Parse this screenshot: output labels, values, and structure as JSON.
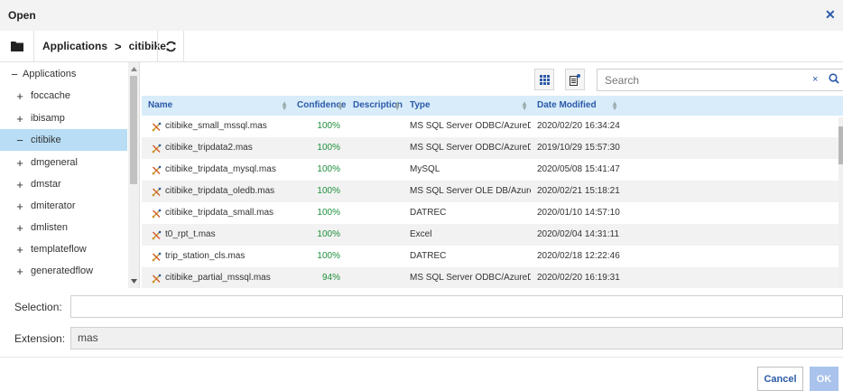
{
  "dialog": {
    "title": "Open"
  },
  "breadcrumb": {
    "root": "Applications",
    "separator": ">",
    "current": "citibike"
  },
  "tree": {
    "items": [
      {
        "expander": "−",
        "label": "Applications",
        "selected": false
      },
      {
        "expander": "+",
        "label": "foccache",
        "selected": false
      },
      {
        "expander": "+",
        "label": "ibisamp",
        "selected": false
      },
      {
        "expander": "−",
        "label": "citibike",
        "selected": true
      },
      {
        "expander": "+",
        "label": "dmgeneral",
        "selected": false
      },
      {
        "expander": "+",
        "label": "dmstar",
        "selected": false
      },
      {
        "expander": "+",
        "label": "dmiterator",
        "selected": false
      },
      {
        "expander": "+",
        "label": "dmlisten",
        "selected": false
      },
      {
        "expander": "+",
        "label": "templateflow",
        "selected": false
      },
      {
        "expander": "+",
        "label": "generatedflow",
        "selected": false
      }
    ]
  },
  "search": {
    "placeholder": "Search",
    "clear": "×"
  },
  "table": {
    "columns": {
      "name": "Name",
      "confidence": "Confidence",
      "description": "Description",
      "type": "Type",
      "date": "Date Modified"
    },
    "rows": [
      {
        "name": "citibike_small_mssql.mas",
        "confidence": "100%",
        "description": "",
        "type": "MS SQL Server ODBC/AzureDB",
        "date": "2020/02/20 16:34:24"
      },
      {
        "name": "citibike_tripdata2.mas",
        "confidence": "100%",
        "description": "",
        "type": "MS SQL Server ODBC/AzureDB",
        "date": "2019/10/29 15:57:30"
      },
      {
        "name": "citibike_tripdata_mysql.mas",
        "confidence": "100%",
        "description": "",
        "type": "MySQL",
        "date": "2020/05/08 15:41:47"
      },
      {
        "name": "citibike_tripdata_oledb.mas",
        "confidence": "100%",
        "description": "",
        "type": "MS SQL Server OLE DB/AzureDB",
        "date": "2020/02/21 15:18:21"
      },
      {
        "name": "citibike_tripdata_small.mas",
        "confidence": "100%",
        "description": "",
        "type": "DATREC",
        "date": "2020/01/10 14:57:10"
      },
      {
        "name": "t0_rpt_t.mas",
        "confidence": "100%",
        "description": "",
        "type": "Excel",
        "date": "2020/02/04 14:31:11"
      },
      {
        "name": "trip_station_cls.mas",
        "confidence": "100%",
        "description": "",
        "type": "DATREC",
        "date": "2020/02/18 12:22:46"
      },
      {
        "name": "citibike_partial_mssql.mas",
        "confidence": "94%",
        "description": "",
        "type": "MS SQL Server ODBC/AzureDB",
        "date": "2020/02/20 16:19:31"
      }
    ]
  },
  "selection": {
    "label": "Selection:",
    "value": ""
  },
  "extension": {
    "label": "Extension:",
    "value": "mas"
  },
  "buttons": {
    "cancel": "Cancel",
    "ok": "OK"
  },
  "colors": {
    "accent": "#2b5aa8",
    "selected_row": "#b8ddf5",
    "header_bg": "#d8ecfa",
    "confidence": "#1d8f3a",
    "ok_disabled": "#a9c3ec"
  }
}
